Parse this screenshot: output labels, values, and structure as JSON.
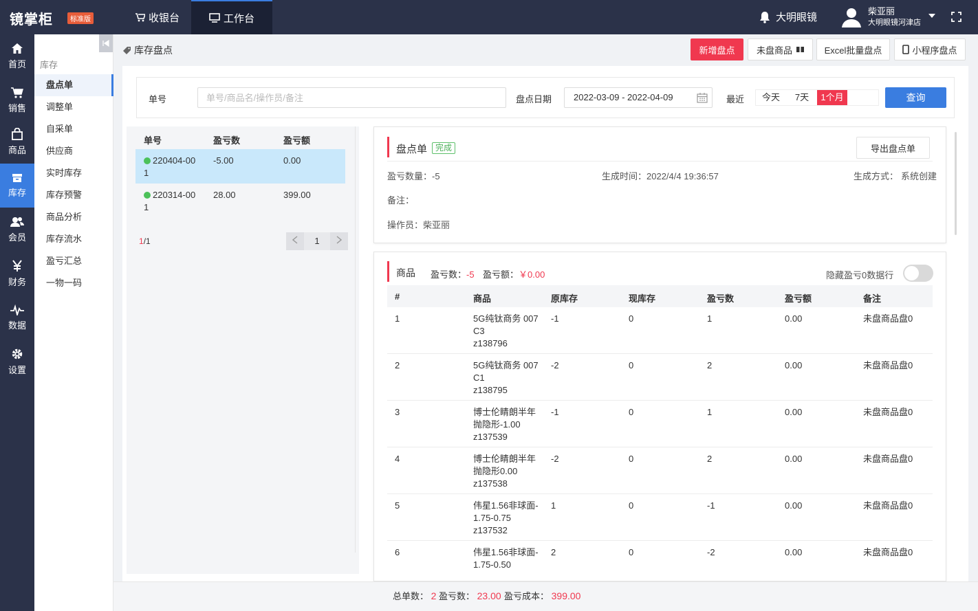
{
  "app": {
    "logo": "镜掌柜",
    "edition": "标准版"
  },
  "topnav": [
    {
      "label": "收银台"
    },
    {
      "label": "工作台"
    }
  ],
  "store": "大明眼镜",
  "user": {
    "name": "柴亚丽",
    "shop": "大明眼镜河津店"
  },
  "rail": [
    "首页",
    "销售",
    "商品",
    "库存",
    "会员",
    "财务",
    "数据",
    "设置"
  ],
  "submenu": {
    "title": "库存",
    "items": [
      "盘点单",
      "调整单",
      "自采单",
      "供应商",
      "实时库存",
      "库存预警",
      "商品分析",
      "库存流水",
      "盈亏汇总",
      "一物一码"
    ]
  },
  "page": {
    "title": "库存盘点"
  },
  "actions": {
    "new": "新增盘点",
    "unchecked": "未盘商品",
    "excel": "Excel批量盘点",
    "mini": "小程序盘点"
  },
  "filter": {
    "no_label": "单号",
    "no_placeholder": "单号/商品名/操作员/备注",
    "date_label": "盘点日期",
    "date_value": "2022-03-09 - 2022-04-09",
    "recent_label": "最近",
    "quick": [
      "今天",
      "7天",
      "1个月"
    ],
    "query": "查询"
  },
  "list": {
    "headers": [
      "单号",
      "盈亏数",
      "盈亏额"
    ],
    "rows": [
      {
        "no_line1": "220404-00",
        "no_line2": "1",
        "qty": "-5.00",
        "amount": "0.00"
      },
      {
        "no_line1": "220314-00",
        "no_line2": "1",
        "qty": "28.00",
        "amount": "399.00"
      }
    ],
    "pager_current": "1",
    "pager_total": "/1",
    "page": "1"
  },
  "detail": {
    "title": "盘点单",
    "status": "完成",
    "export": "导出盘点单",
    "qty_label": "盈亏数量：",
    "qty_value": "-5",
    "time_label": "生成时间：",
    "time_value": "2022/4/4 19:36:57",
    "mode_label": "生成方式：",
    "mode_value": "系统创建",
    "remark_label": "备注：",
    "operator_label": "操作员：",
    "operator_value": "柴亚丽"
  },
  "goods": {
    "title": "商品",
    "qty_label": "盈亏数：",
    "qty_value": "-5",
    "amount_label": "盈亏额：",
    "amount_value": "￥0.00",
    "hide_zero": "隐藏盈亏0数据行",
    "headers": [
      "#",
      "商品",
      "原库存",
      "现库存",
      "盈亏数",
      "盈亏额",
      "备注"
    ],
    "rows": [
      {
        "idx": "1",
        "name1": "5G纯钛商务 007",
        "name2": "C3",
        "code": "z138796",
        "orig": "-1",
        "now": "0",
        "diff": "1",
        "amount": "0.00",
        "note": "未盘商品盘0"
      },
      {
        "idx": "2",
        "name1": "5G纯钛商务 007",
        "name2": "C1",
        "code": "z138795",
        "orig": "-2",
        "now": "0",
        "diff": "2",
        "amount": "0.00",
        "note": "未盘商品盘0"
      },
      {
        "idx": "3",
        "name1": "博士伦睛朗半年",
        "name2": "抛隐形-1.00",
        "code": "z137539",
        "orig": "-1",
        "now": "0",
        "diff": "1",
        "amount": "0.00",
        "note": "未盘商品盘0"
      },
      {
        "idx": "4",
        "name1": "博士伦睛朗半年",
        "name2": "抛隐形0.00",
        "code": "z137538",
        "orig": "-2",
        "now": "0",
        "diff": "2",
        "amount": "0.00",
        "note": "未盘商品盘0"
      },
      {
        "idx": "5",
        "name1": "伟星1.56非球面-",
        "name2": "1.75-0.75",
        "code": "z137532",
        "orig": "1",
        "now": "0",
        "diff": "-1",
        "amount": "0.00",
        "note": "未盘商品盘0"
      },
      {
        "idx": "6",
        "name1": "伟星1.56非球面-",
        "name2": "1.75-0.50",
        "code": "",
        "orig": "2",
        "now": "0",
        "diff": "-2",
        "amount": "0.00",
        "note": "未盘商品盘0"
      }
    ]
  },
  "footer": {
    "count_label": "总单数：",
    "count_value": "2",
    "qty_label": "盈亏数：",
    "qty_value": "23.00",
    "cost_label": "盈亏成本：",
    "cost_value": "399.00"
  },
  "colors": {
    "nav_bg": "#2b3249",
    "accent": "#3a7de0",
    "danger": "#f0384f",
    "success": "#4cc15a"
  }
}
